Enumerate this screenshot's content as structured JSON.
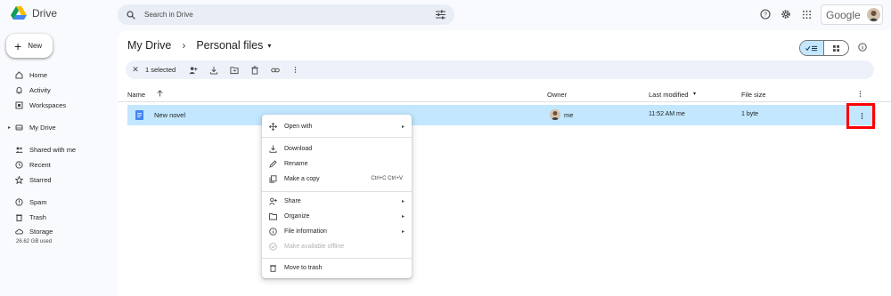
{
  "app": {
    "name": "Drive",
    "account_brand": "Google"
  },
  "search": {
    "placeholder": "Search in Drive"
  },
  "sidebar": {
    "new_label": "New",
    "items": [
      {
        "label": "Home",
        "icon": "home-icon"
      },
      {
        "label": "Activity",
        "icon": "activity-icon"
      },
      {
        "label": "Workspaces",
        "icon": "workspaces-icon"
      },
      {
        "label": "My Drive",
        "icon": "my-drive-icon"
      },
      {
        "label": "Shared with me",
        "icon": "people-icon"
      },
      {
        "label": "Recent",
        "icon": "clock-icon"
      },
      {
        "label": "Starred",
        "icon": "star-icon"
      },
      {
        "label": "Spam",
        "icon": "spam-icon"
      },
      {
        "label": "Trash",
        "icon": "trash-icon"
      },
      {
        "label": "Storage",
        "icon": "cloud-icon"
      }
    ],
    "storage_used": "26.62 GB used"
  },
  "breadcrumb": {
    "root": "My Drive",
    "current": "Personal files"
  },
  "selection_bar": {
    "label": "1 selected"
  },
  "table": {
    "headers": {
      "name": "Name",
      "owner": "Owner",
      "modified": "Last modified",
      "size": "File size"
    },
    "rows": [
      {
        "name": "New novel",
        "owner": "me",
        "modified": "11:52 AM me",
        "size": "1 byte"
      }
    ]
  },
  "context_menu": {
    "items": [
      {
        "label": "Open with",
        "icon": "open-with-icon",
        "submenu": true
      },
      {
        "label": "Download",
        "icon": "download-icon"
      },
      {
        "label": "Rename",
        "icon": "rename-icon"
      },
      {
        "label": "Make a copy",
        "icon": "copy-icon",
        "shortcut": "Ctrl+C Ctrl+V"
      },
      {
        "label": "Share",
        "icon": "share-icon",
        "submenu": true
      },
      {
        "label": "Organize",
        "icon": "folder-icon",
        "submenu": true
      },
      {
        "label": "File information",
        "icon": "info-icon",
        "submenu": true
      },
      {
        "label": "Make available offline",
        "icon": "offline-icon",
        "disabled": true
      },
      {
        "label": "Move to trash",
        "icon": "trash-icon"
      }
    ]
  },
  "colors": {
    "selected_row": "#c2e7ff",
    "highlight": "#ff0000",
    "accent": "#0b57d0"
  }
}
